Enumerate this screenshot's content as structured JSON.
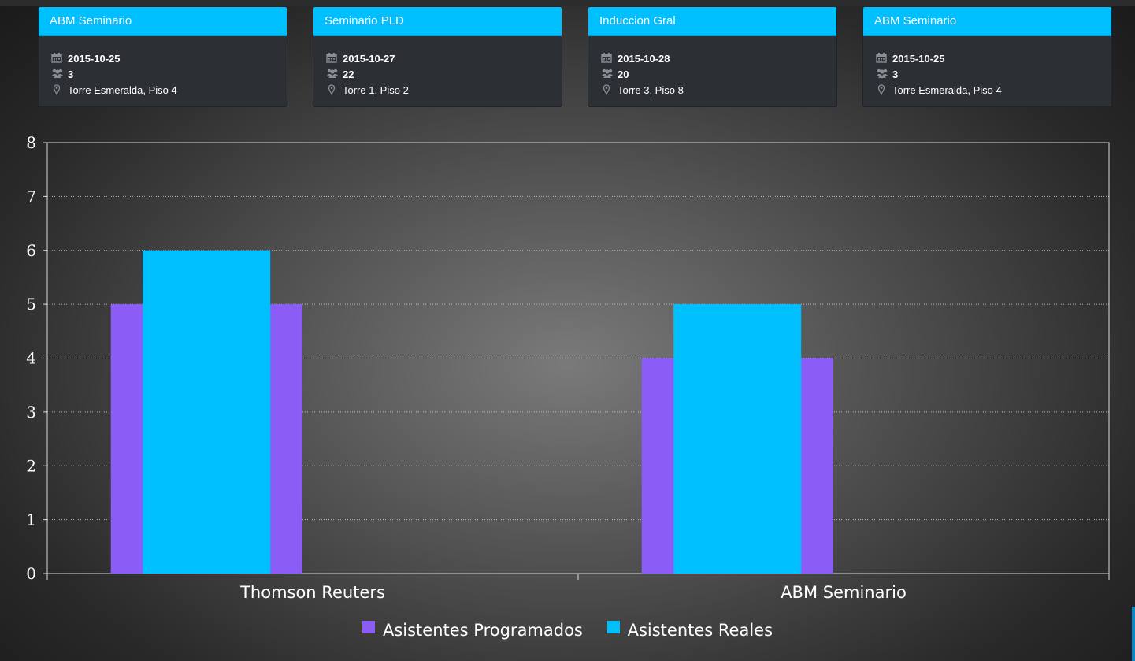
{
  "cards": [
    {
      "title": "ABM Seminario",
      "date": "2015-10-25",
      "attendees": "3",
      "location": "Torre Esmeralda, Piso 4"
    },
    {
      "title": "Seminario PLD",
      "date": "2015-10-27",
      "attendees": "22",
      "location": "Torre 1, Piso 2"
    },
    {
      "title": "Induccion Gral",
      "date": "2015-10-28",
      "attendees": "20",
      "location": "Torre 3, Piso 8"
    },
    {
      "title": "ABM Seminario",
      "date": "2015-10-25",
      "attendees": "3",
      "location": "Torre Esmeralda, Piso 4"
    }
  ],
  "icons": {
    "date": "calendar-icon",
    "attendees": "users-icon",
    "location": "map-marker-icon"
  },
  "colors": {
    "card_header": "#00bfff",
    "series_programados": "#8b5cf6",
    "series_reales": "#00bfff"
  },
  "chart_data": {
    "type": "bar",
    "categories": [
      "Thomson Reuters",
      "ABM Seminario"
    ],
    "series": [
      {
        "name": "Asistentes Programados",
        "values": [
          5,
          4
        ],
        "color": "#8b5cf6"
      },
      {
        "name": "Asistentes Reales",
        "values": [
          6,
          5
        ],
        "color": "#00bfff"
      }
    ],
    "ylim": [
      0,
      8
    ],
    "yticks": [
      0,
      1,
      2,
      3,
      4,
      5,
      6,
      7,
      8
    ],
    "grid": true,
    "legend_position": "bottom"
  }
}
